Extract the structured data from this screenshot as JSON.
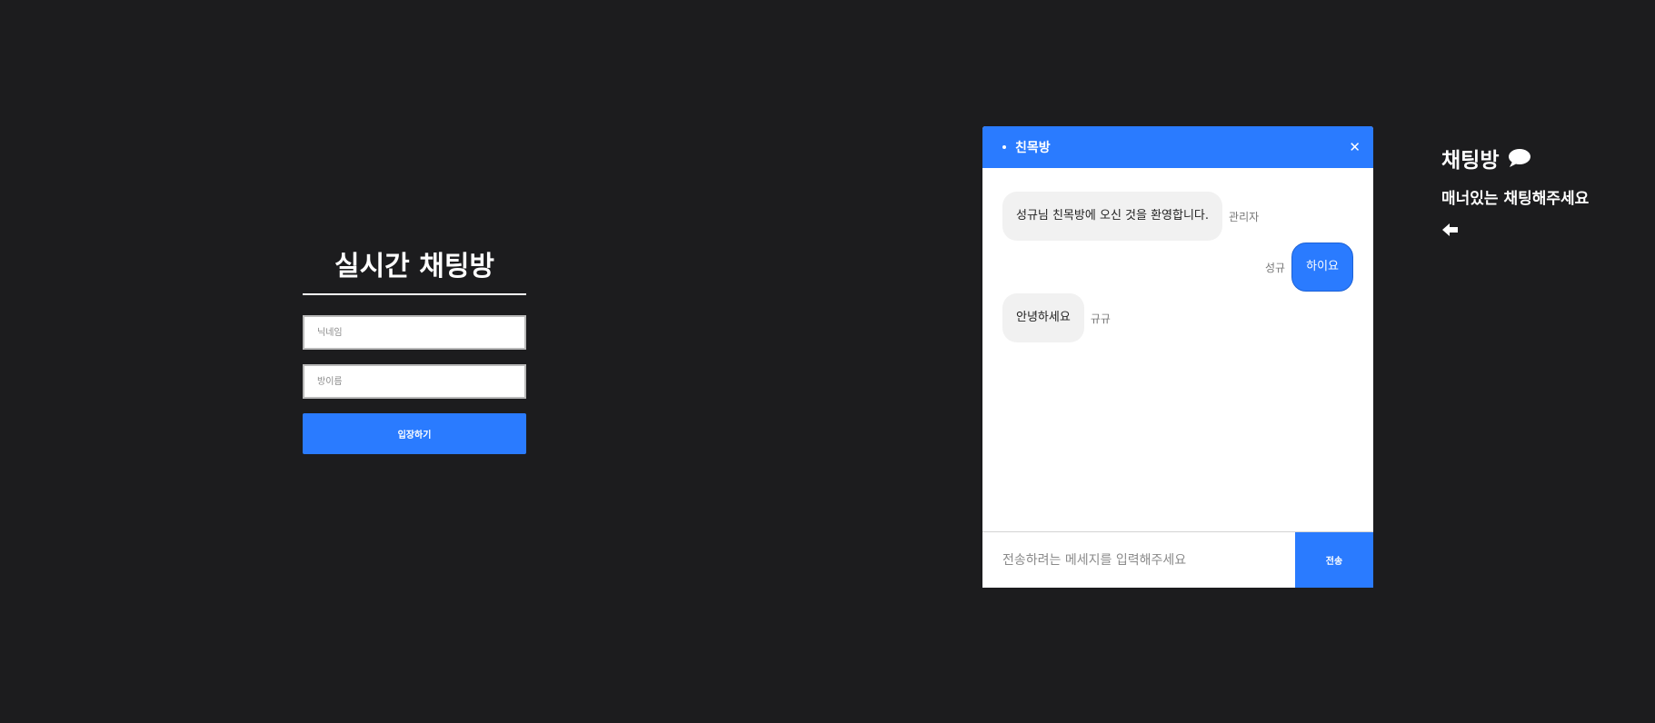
{
  "login": {
    "title": "실시간 채팅방",
    "nickname_placeholder": "닉네임",
    "room_placeholder": "방이름",
    "enter_label": "입장하기"
  },
  "chat": {
    "room_name": "친목방",
    "close_icon": "close-icon",
    "messages": [
      {
        "sender": "관리자",
        "text": "성규님 친목방에 오신 것을 환영합니다.",
        "side": "left"
      },
      {
        "sender": "성규",
        "text": "하이요",
        "side": "right"
      },
      {
        "sender": "규규",
        "text": "안녕하세요",
        "side": "left"
      }
    ],
    "input_placeholder": "전송하려는 메세지를 입력해주세요",
    "send_label": "전송"
  },
  "info": {
    "title": "채팅방",
    "title_icon": "speech-bubble-icon",
    "subtitle": "매너있는 채팅해주세요",
    "back_icon": "arrow-left-icon"
  },
  "colors": {
    "background": "#1c1c1e",
    "accent": "#2a7bff",
    "bubble_other": "#f1f1f1"
  }
}
